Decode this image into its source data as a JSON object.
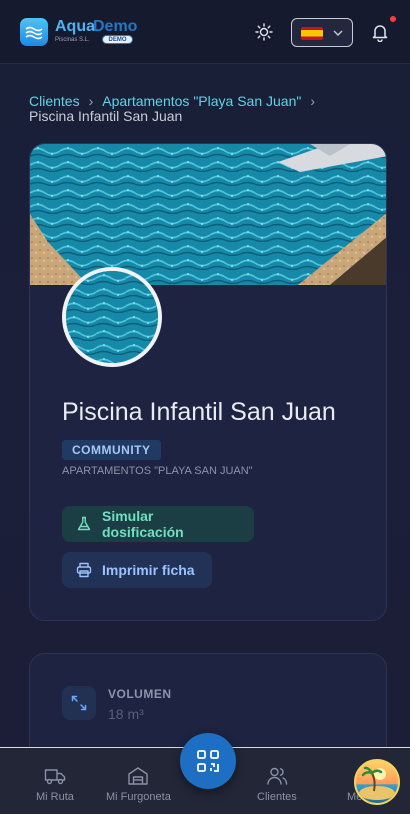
{
  "header": {
    "brand_primary": "Aqua",
    "brand_secondary": "Demo",
    "brand_sub": "Piscinas S.L.",
    "demo_badge": "DEMO",
    "language_flag": "es",
    "colors": {
      "accent": "#1f78c8",
      "brand_light": "#4fb3f0",
      "notification": "#ff3b3b"
    }
  },
  "breadcrumb": {
    "items": [
      "Clientes",
      "Apartamentos \"Playa San Juan\""
    ],
    "separator": "›",
    "current": "Piscina Infantil San Juan"
  },
  "pool": {
    "name": "Piscina Infantil San Juan",
    "tag": "COMMUNITY",
    "client": "APARTAMENTOS \"PLAYA SAN JUAN\"",
    "simulate_label": "Simular dosificación",
    "print_label": "Imprimir ficha"
  },
  "stats": {
    "volume_label": "VOLUMEN",
    "volume_value": "18 m³"
  },
  "nav": {
    "route": "Mi Ruta",
    "van": "Mi Furgoneta",
    "clients": "Clientes",
    "more": "Mé"
  },
  "icons": [
    "sun-icon",
    "chevron-down-icon",
    "bell-icon",
    "flask-icon",
    "printer-icon",
    "expand-icon",
    "truck-icon",
    "warehouse-icon",
    "qr-code-icon",
    "users-icon"
  ]
}
